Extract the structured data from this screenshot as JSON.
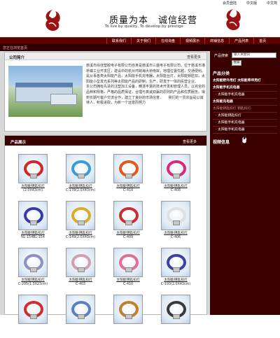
{
  "toplinks": [
    "会员登陆",
    "中文版",
    "中文简"
  ],
  "header": {
    "slogan_cn": "质量为本　诚信经营",
    "slogan_en": "To live by quality, To develop by prestige"
  },
  "nav": [
    "联系我们",
    "关于我们",
    "在线询盘",
    "视频展示",
    "商铺信息",
    "产品列表",
    "首页"
  ],
  "subbar": "您正在浏览首页",
  "intro": {
    "title": "公司简介",
    "more": "查看更多",
    "text": "慈溪市尚佳塑胶电子有限公司自身是慈溪市三盛电子有限公司，位于慈溪市港桥镇工业开发区，建设中的杭州湾跨海大桥南岸，地理位置优越，交通便利。是从事各类太阳能产品，太阳能手机充电器，太阳能台灯，太阳能钥匙扣，太阳能小型发光系列等太阳能产品的研制，生产，研发于一体的民营企业。　　本公司拥有先进的注塑加工设备，精湛丰富的技术开发和管理人员，以完全的品种和规格，严格的品质保证，合理与真诚双赢的原则的产品和优质服务。得到长期与客户交流合作，建立了良好的市场信誉。　　我们的一贯宗旨是以诚待人，积极进取，为新一个远景而努力"
  },
  "products": {
    "title": "产品展示",
    "more": "查看更多",
    "items": [
      {
        "name": "太阳能钥匙扣灯",
        "code": "(2.0X43cm)",
        "color": "#cc2a2a"
      },
      {
        "name": "太阳能钥匙扣灯",
        "code": "C-178(2.0X43cm)",
        "color": "#3a9adb"
      },
      {
        "name": "太阳能钥匙扣灯",
        "code": "C-414",
        "color": "#e05a1a"
      },
      {
        "name": "太阳能钥匙扣灯",
        "code": "C-408",
        "color": "#d92a7a"
      },
      {
        "name": "太阳能钥匙扣灯",
        "code": "NL-154BL-154",
        "color": "#3a3ab0"
      },
      {
        "name": "太阳能钥匙扣灯",
        "code": "C-149(2.0X43cm)",
        "color": "#d7ad2a"
      },
      {
        "name": "太阳能钥匙扣灯",
        "code": "C-409",
        "color": "#c73030"
      },
      {
        "name": "太阳能钥匙扣灯",
        "code": "C-406",
        "color": "#e0e0e0"
      },
      {
        "name": "太阳能钥匙扣灯",
        "code": "C-205(1.3X23cm)",
        "color": "#9090c0"
      },
      {
        "name": "太阳能钥匙扣灯",
        "code": "C-403",
        "color": "#d0a0b0"
      },
      {
        "name": "太阳能钥匙扣灯",
        "code": "C-410",
        "color": "#e07090"
      },
      {
        "name": "太阳能钥匙扣灯",
        "code": "C-193(2.0X43cm)",
        "color": "#4040a0"
      },
      {
        "name": "",
        "code": "",
        "color": "#cc3030"
      },
      {
        "name": "",
        "code": "",
        "color": "#5a80c0"
      },
      {
        "name": "",
        "code": "",
        "color": "#c08030"
      },
      {
        "name": "",
        "code": "",
        "color": "#3a3a3a"
      }
    ]
  },
  "sidebar": {
    "search_label": "产品搜索",
    "search_placeholder": "输入关键词",
    "search_button": "搜索",
    "cat_title": "产品分类",
    "categories": [
      {
        "label": "太阳能野外用灯 太阳能草坪用灯",
        "style": "b"
      },
      {
        "label": "太阳能手机充电器",
        "style": "b"
      },
      {
        "label": "· 太阳能手机充电器",
        "style": "sub"
      },
      {
        "label": "太阳能充电器",
        "style": "b"
      },
      {
        "label": "太阳能钥匙扣灯 钥匙扣灯",
        "style": "dim"
      },
      {
        "label": "· 太阳能钥匙扣灯",
        "style": "sub"
      },
      {
        "label": "· 太阳能手机充电器",
        "style": "sub"
      },
      {
        "label": "· 太阳能手机充电器",
        "style": "sub"
      }
    ],
    "video_title": "视频信息"
  },
  "colors": {
    "nav": "#5c0000",
    "sidebar": "#3a0000",
    "logo": "#9a1414"
  }
}
